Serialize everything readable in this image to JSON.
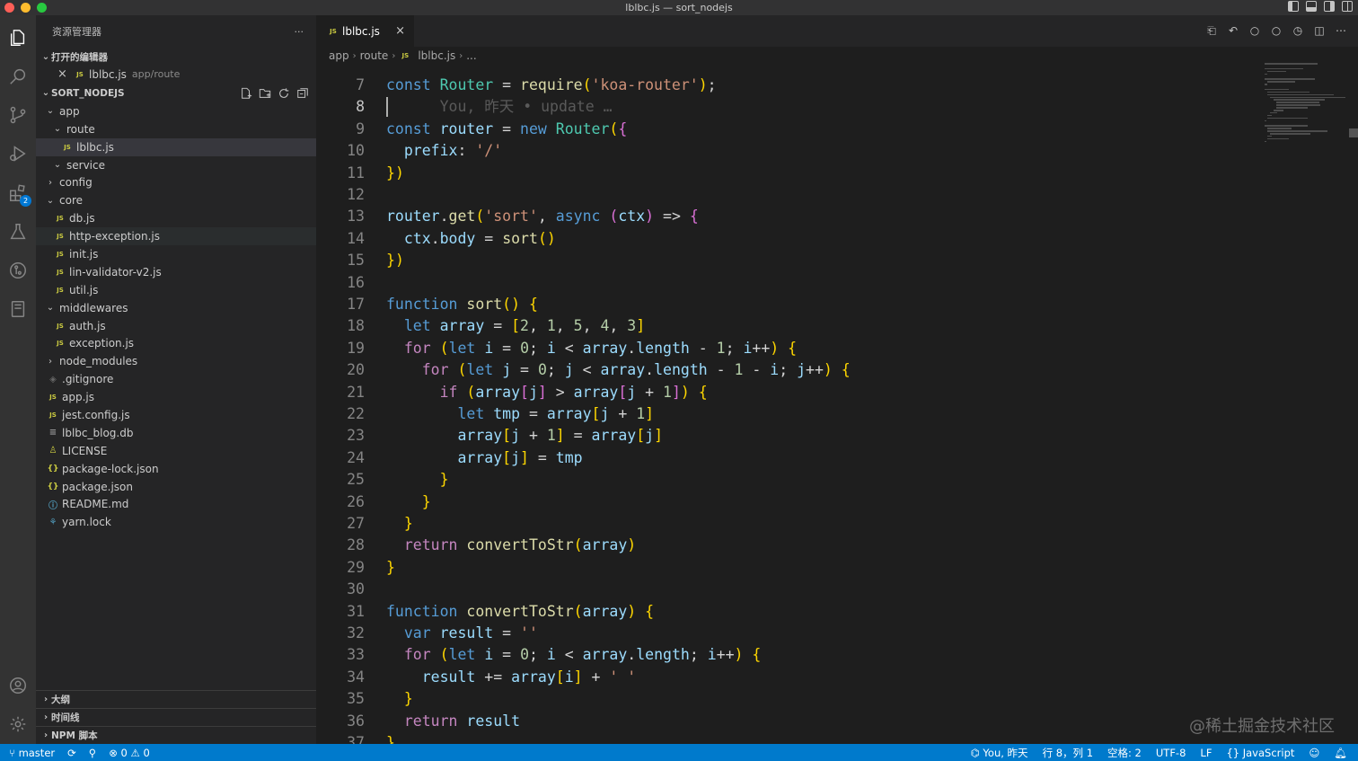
{
  "window": {
    "title": "lblbc.js — sort_nodejs"
  },
  "sidebar": {
    "title": "资源管理器",
    "more": "···",
    "open_editors": {
      "label": "打开的编辑器",
      "items": [
        {
          "name": "lblbc.js",
          "path": "app/route"
        }
      ]
    },
    "project": {
      "label": "SORT_NODEJS",
      "tree": [
        {
          "label": "app",
          "depth": 1,
          "type": "folder",
          "open": true
        },
        {
          "label": "route",
          "depth": 2,
          "type": "folder",
          "open": true
        },
        {
          "label": "lblbc.js",
          "depth": 3,
          "type": "js",
          "selected": true
        },
        {
          "label": "service",
          "depth": 2,
          "type": "folder",
          "open": true
        },
        {
          "label": "config",
          "depth": 1,
          "type": "folder",
          "open": false
        },
        {
          "label": "core",
          "depth": 1,
          "type": "folder",
          "open": true
        },
        {
          "label": "db.js",
          "depth": 2,
          "type": "js"
        },
        {
          "label": "http-exception.js",
          "depth": 2,
          "type": "js",
          "hover": true
        },
        {
          "label": "init.js",
          "depth": 2,
          "type": "js"
        },
        {
          "label": "lin-validator-v2.js",
          "depth": 2,
          "type": "js"
        },
        {
          "label": "util.js",
          "depth": 2,
          "type": "js"
        },
        {
          "label": "middlewares",
          "depth": 1,
          "type": "folder",
          "open": true
        },
        {
          "label": "auth.js",
          "depth": 2,
          "type": "js"
        },
        {
          "label": "exception.js",
          "depth": 2,
          "type": "js"
        },
        {
          "label": "node_modules",
          "depth": 1,
          "type": "folder",
          "open": false
        },
        {
          "label": ".gitignore",
          "depth": 1,
          "type": "git"
        },
        {
          "label": "app.js",
          "depth": 1,
          "type": "js"
        },
        {
          "label": "jest.config.js",
          "depth": 1,
          "type": "js"
        },
        {
          "label": "lblbc_blog.db",
          "depth": 1,
          "type": "db"
        },
        {
          "label": "LICENSE",
          "depth": 1,
          "type": "lic"
        },
        {
          "label": "package-lock.json",
          "depth": 1,
          "type": "json"
        },
        {
          "label": "package.json",
          "depth": 1,
          "type": "json"
        },
        {
          "label": "README.md",
          "depth": 1,
          "type": "info"
        },
        {
          "label": "yarn.lock",
          "depth": 1,
          "type": "yarn"
        }
      ]
    },
    "bottom_sections": [
      "大纲",
      "时间线",
      "NPM 脚本"
    ]
  },
  "activity": {
    "extensions_badge": "2"
  },
  "editor": {
    "tab": {
      "label": "lblbc.js",
      "close": "×"
    },
    "breadcrumb": [
      "app",
      "route",
      "lblbc.js",
      "..."
    ],
    "first_line": 7,
    "active_line": 8,
    "blame": "You, 昨天 • update …",
    "lines": [
      "const Router = require('koa-router');",
      "",
      "const router = new Router({",
      "  prefix: '/'",
      "})",
      "",
      "router.get('sort', async (ctx) => {",
      "  ctx.body = sort()",
      "})",
      "",
      "function sort() {",
      "  let array = [2, 1, 5, 4, 3]",
      "  for (let i = 0; i < array.length - 1; i++) {",
      "    for (let j = 0; j < array.length - 1 - i; j++) {",
      "      if (array[j] > array[j + 1]) {",
      "        let tmp = array[j + 1]",
      "        array[j + 1] = array[j]",
      "        array[j] = tmp",
      "      }",
      "    }",
      "  }",
      "  return convertToStr(array)",
      "}",
      "",
      "function convertToStr(array) {",
      "  var result = ''",
      "  for (let i = 0; i < array.length; i++) {",
      "    result += array[i] + ' '",
      "  }",
      "  return result",
      "}"
    ],
    "watermark": "@稀土掘金技术社区"
  },
  "statusbar": {
    "branch": "master",
    "errors": "0",
    "warnings": "0",
    "blame": "You, 昨天",
    "position": "行 8，列 1",
    "spaces": "空格: 2",
    "encoding": "UTF-8",
    "eol": "LF",
    "language": "JavaScript"
  }
}
